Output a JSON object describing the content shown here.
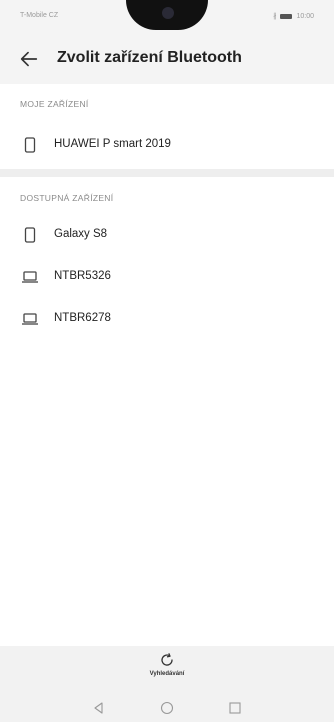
{
  "status_bar": {
    "carrier": "T-Mobile CZ",
    "time": "10:00",
    "bluetooth_glyph": "∦"
  },
  "header": {
    "title": "Zvolit zařízení Bluetooth",
    "back_icon": "arrow-left-icon"
  },
  "my_devices": {
    "header": "MOJE ZAŘÍZENÍ",
    "items": [
      {
        "label": "HUAWEI P smart 2019",
        "icon": "phone-icon"
      }
    ]
  },
  "available_devices": {
    "header": "DOSTUPNÁ ZAŘÍZENÍ",
    "items": [
      {
        "label": "Galaxy S8",
        "icon": "phone-icon"
      },
      {
        "label": "NTBR5326",
        "icon": "laptop-icon"
      },
      {
        "label": "NTBR6278",
        "icon": "laptop-icon"
      }
    ]
  },
  "bottom_action": {
    "label": "Vyhledávání",
    "icon": "refresh-icon"
  },
  "navigation": {
    "back": "triangle-back-icon",
    "home": "circle-home-icon",
    "recents": "square-recents-icon"
  }
}
